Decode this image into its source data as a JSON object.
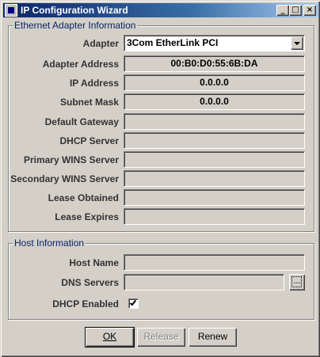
{
  "window": {
    "title": "IP Configuration Wizard",
    "controls": {
      "minimize": "_",
      "maximize": "□",
      "close": "×"
    }
  },
  "ethernet": {
    "legend": "Ethernet Adapter Information",
    "adapter_label": "Adapter",
    "adapter_value": "3Com EtherLink PCI",
    "rows": [
      {
        "label": "Adapter Address",
        "value": "00:B0:D0:55:6B:DA"
      },
      {
        "label": "IP Address",
        "value": "0.0.0.0"
      },
      {
        "label": "Subnet Mask",
        "value": "0.0.0.0"
      },
      {
        "label": "Default Gateway",
        "value": ""
      },
      {
        "label": "DHCP Server",
        "value": ""
      },
      {
        "label": "Primary WINS Server",
        "value": ""
      },
      {
        "label": "Secondary WINS Server",
        "value": ""
      },
      {
        "label": "Lease Obtained",
        "value": ""
      },
      {
        "label": "Lease Expires",
        "value": ""
      }
    ]
  },
  "host": {
    "legend": "Host Information",
    "host_name_label": "Host Name",
    "host_name_value": "",
    "dns_label": "DNS Servers",
    "dns_value": "",
    "dns_button": "...",
    "dhcp_label": "DHCP Enabled",
    "dhcp_checked": true
  },
  "buttons": {
    "ok": "OK",
    "release": "Release",
    "renew": "Renew"
  }
}
